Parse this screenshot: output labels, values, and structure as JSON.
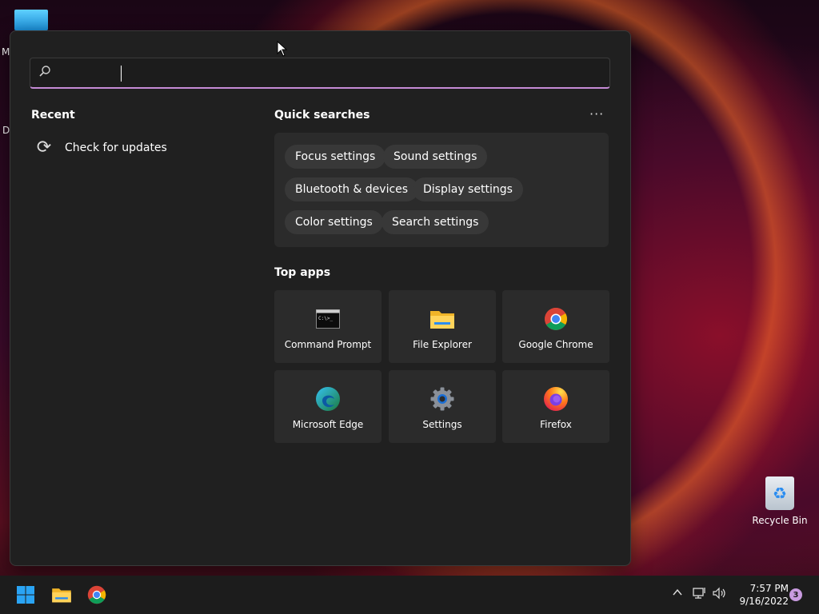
{
  "desktop": {
    "clipped_label_1": "M",
    "clipped_label_2": "Da",
    "recycle_bin": "Recycle Bin"
  },
  "search": {
    "placeholder": "",
    "value": ""
  },
  "recent": {
    "title": "Recent",
    "items": [
      {
        "label": "Check for updates",
        "icon": "refresh-icon"
      }
    ]
  },
  "quick_searches": {
    "title": "Quick searches",
    "more": "···",
    "chips": [
      "Focus settings",
      "Sound settings",
      "Bluetooth & devices",
      "Display settings",
      "Color settings",
      "Search settings"
    ]
  },
  "top_apps": {
    "title": "Top apps",
    "apps": [
      {
        "label": "Command Prompt",
        "icon": "command-prompt-icon"
      },
      {
        "label": "File Explorer",
        "icon": "file-explorer-icon"
      },
      {
        "label": "Google Chrome",
        "icon": "chrome-icon"
      },
      {
        "label": "Microsoft Edge",
        "icon": "edge-icon"
      },
      {
        "label": "Settings",
        "icon": "settings-gear-icon"
      },
      {
        "label": "Firefox",
        "icon": "firefox-icon"
      }
    ]
  },
  "taskbar": {
    "time": "7:57 PM",
    "date": "9/16/2022",
    "notification_count": "3"
  },
  "colors": {
    "panel_bg": "#202020",
    "tile_bg": "#2b2b2b",
    "accent_underline": "#c58bd6"
  }
}
